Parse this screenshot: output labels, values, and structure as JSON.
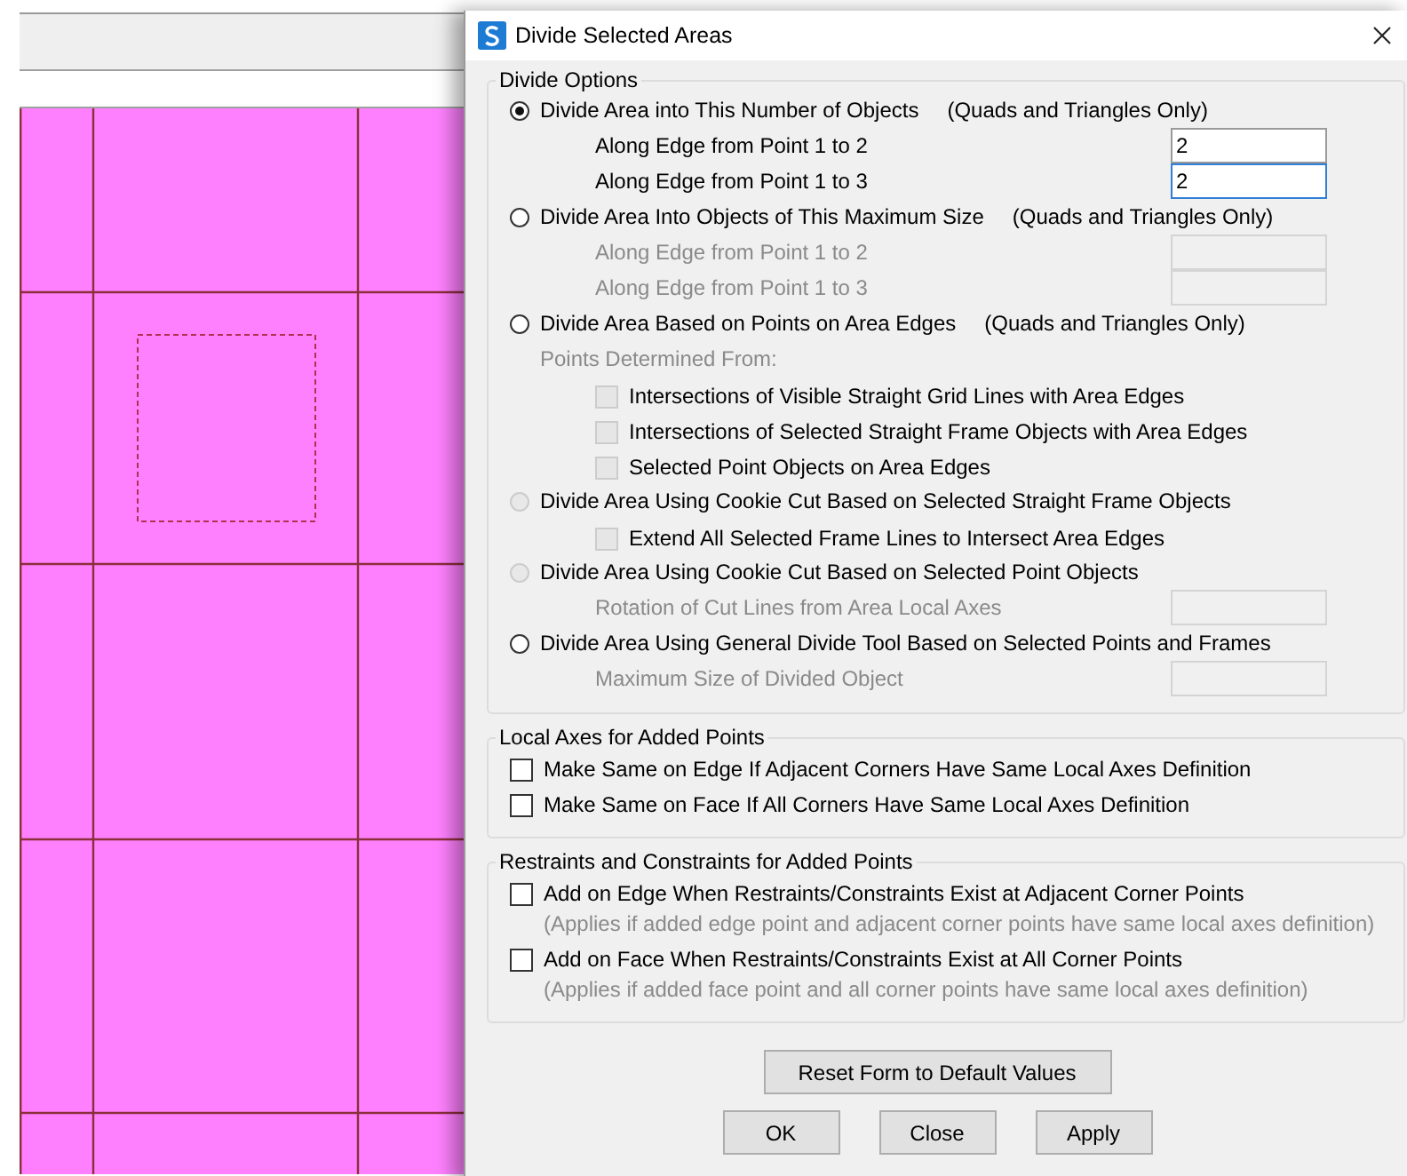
{
  "dialog": {
    "title": "Divide Selected Areas",
    "groups": [
      {
        "title": "Divide Options",
        "rows": [
          {
            "kind": "radio",
            "label": "Divide Area into This Number of Objects",
            "note": "(Quads and Triangles Only)",
            "selected": true,
            "disabled": false,
            "children": [
              {
                "kind": "field",
                "label": "Along Edge from Point 1 to 2",
                "value": "2",
                "disabled": false,
                "focused": false
              },
              {
                "kind": "field",
                "label": "Along Edge from Point 1 to 3",
                "value": "2",
                "disabled": false,
                "focused": true
              }
            ]
          },
          {
            "kind": "radio",
            "label": "Divide Area Into Objects of This Maximum Size",
            "note": "(Quads and Triangles Only)",
            "selected": false,
            "disabled": false,
            "children": [
              {
                "kind": "field",
                "label": "Along Edge from Point 1 to 2",
                "disabled": true,
                "focused": false
              },
              {
                "kind": "field",
                "label": "Along Edge from Point 1 to 3",
                "disabled": true,
                "focused": false
              }
            ]
          },
          {
            "kind": "radio",
            "label": "Divide Area Based on Points on Area Edges",
            "note": "(Quads and Triangles Only)",
            "selected": false,
            "disabled": false,
            "children": [
              {
                "kind": "caption",
                "label": "Points Determined From:",
                "disabled": true
              },
              {
                "kind": "checkbox",
                "label": "Intersections of Visible Straight Grid Lines with Area Edges",
                "checked": false,
                "disabled": true
              },
              {
                "kind": "checkbox",
                "label": "Intersections of Selected Straight Frame Objects with Area Edges",
                "checked": false,
                "disabled": true
              },
              {
                "kind": "checkbox",
                "label": "Selected Point Objects on Area Edges",
                "checked": false,
                "disabled": true
              }
            ]
          },
          {
            "kind": "radio",
            "label": "Divide Area Using Cookie Cut Based on Selected Straight Frame Objects",
            "selected": false,
            "disabled": true,
            "children": [
              {
                "kind": "checkbox",
                "label": "Extend All Selected Frame Lines to Intersect Area Edges",
                "checked": false,
                "disabled": true
              }
            ]
          },
          {
            "kind": "radio",
            "label": "Divide Area Using Cookie Cut Based on Selected Point Objects",
            "selected": false,
            "disabled": true,
            "children": [
              {
                "kind": "field",
                "label": "Rotation of Cut Lines from Area Local Axes",
                "disabled": true,
                "focused": false
              }
            ]
          },
          {
            "kind": "radio",
            "label": "Divide Area Using General Divide Tool Based on Selected Points and Frames",
            "selected": false,
            "disabled": false,
            "children": [
              {
                "kind": "field",
                "label": "Maximum Size of Divided Object",
                "disabled": true,
                "focused": false
              }
            ]
          }
        ]
      },
      {
        "title": "Local Axes for Added Points",
        "rows": [
          {
            "kind": "checkbox",
            "label": "Make Same on Edge If Adjacent Corners Have Same Local Axes Definition",
            "checked": false,
            "disabled": false
          },
          {
            "kind": "checkbox",
            "label": "Make Same on Face If All Corners Have Same Local Axes Definition",
            "checked": false,
            "disabled": false
          }
        ]
      },
      {
        "title": "Restraints and Constraints for Added Points",
        "rows": [
          {
            "kind": "checkbox",
            "label": "Add on Edge When Restraints/Constraints Exist at Adjacent Corner Points",
            "hint": "(Applies if added edge point and adjacent corner points have same local axes definition)",
            "checked": false,
            "disabled": false
          },
          {
            "kind": "checkbox",
            "label": "Add on Face When Restraints/Constraints Exist at All Corner Points",
            "hint": "(Applies if added face point and all corner points have same local axes definition)",
            "checked": false,
            "disabled": false
          }
        ]
      }
    ],
    "reset_button": "Reset Form to Default Values",
    "buttons": [
      "OK",
      "Close",
      "Apply"
    ]
  }
}
